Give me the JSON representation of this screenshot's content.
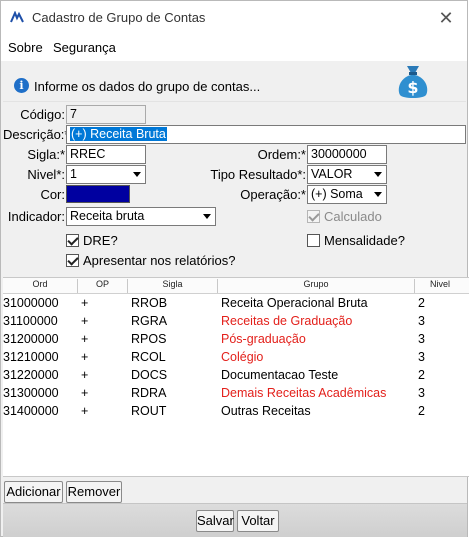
{
  "window": {
    "title": "Cadastro de Grupo de Contas",
    "close_glyph": "✕"
  },
  "menu": {
    "items": [
      "Sobre",
      "Segurança"
    ]
  },
  "info": {
    "text": "Informe os dados do grupo de contas..."
  },
  "form": {
    "codigo_label": "Código:",
    "codigo": "7",
    "descricao_label": "Descrição:*",
    "descricao": "(+) Receita Bruta",
    "sigla_label": "Sigla:*",
    "sigla": "RREC",
    "ordem_label": "Ordem:*",
    "ordem": "30000000",
    "nivel_label": "Nivel*:",
    "nivel": "1",
    "tipo_label": "Tipo Resultado*:",
    "tipo": "VALOR",
    "cor_label": "Cor:",
    "cor_value": "#0000a0",
    "operacao_label": "Operação:*",
    "operacao": "(+) Soma",
    "indicador_label": "Indicador:",
    "indicador": "Receita bruta",
    "calculado_label": "Calculado",
    "calculado": true,
    "dre_label": "DRE?",
    "dre": true,
    "mensalidade_label": "Mensalidade?",
    "mensalidade": false,
    "relatorios_label": "Apresentar nos relatórios?",
    "relatorios": true
  },
  "table": {
    "headers": [
      "Ord",
      "OP",
      "Sigla",
      "Grupo",
      "Nivel"
    ],
    "rows": [
      {
        "ord": "31000000",
        "op": "+",
        "sigla": "RROB",
        "grupo": "Receita Operacional Bruta",
        "nivel": "2",
        "red": false
      },
      {
        "ord": "31100000",
        "op": "+",
        "sigla": "RGRA",
        "grupo": "Receitas de Graduação",
        "nivel": "3",
        "red": true
      },
      {
        "ord": "31200000",
        "op": "+",
        "sigla": "RPOS",
        "grupo": "Pós-graduação",
        "nivel": "3",
        "red": true
      },
      {
        "ord": "31210000",
        "op": "+",
        "sigla": "RCOL",
        "grupo": "Colégio",
        "nivel": "3",
        "red": true
      },
      {
        "ord": "31220000",
        "op": "+",
        "sigla": "DOCS",
        "grupo": "Documentacao Teste",
        "nivel": "2",
        "red": false
      },
      {
        "ord": "31300000",
        "op": "+",
        "sigla": "RDRA",
        "grupo": "Demais Receitas Acadêmicas",
        "nivel": "3",
        "red": true
      },
      {
        "ord": "31400000",
        "op": "+",
        "sigla": "ROUT",
        "grupo": "Outras Receitas",
        "nivel": "2",
        "red": false
      }
    ]
  },
  "buttons": {
    "adicionar": "Adicionar",
    "remover": "Remover",
    "salvar": "Salvar",
    "voltar": "Voltar"
  },
  "colors": {
    "red_text": "#e3201b",
    "selection": "#0078d7",
    "cor_swatch": "#0000a0"
  }
}
